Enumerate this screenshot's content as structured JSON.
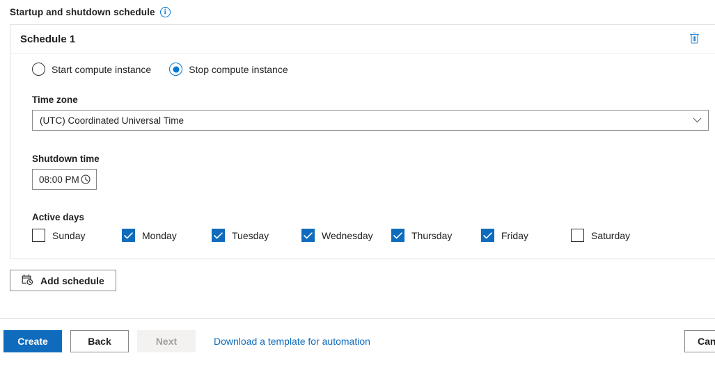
{
  "section": {
    "title": "Startup and shutdown schedule",
    "info_icon": "info-icon",
    "info_glyph": "i"
  },
  "card": {
    "title": "Schedule 1",
    "delete_icon": "trash-icon",
    "delete_color": "#0f6cbd",
    "action_radios": {
      "options": [
        {
          "label": "Start compute instance",
          "selected": false
        },
        {
          "label": "Stop compute instance",
          "selected": true
        }
      ]
    },
    "timezone": {
      "label": "Time zone",
      "value": "(UTC) Coordinated Universal Time",
      "chevron_icon": "chevron-down-icon"
    },
    "shutdown_time": {
      "label": "Shutdown time",
      "value": "08:00 PM",
      "clock_icon": "clock-icon"
    },
    "active_days": {
      "label": "Active days",
      "days": [
        {
          "label": "Sunday",
          "checked": false
        },
        {
          "label": "Monday",
          "checked": true
        },
        {
          "label": "Tuesday",
          "checked": true
        },
        {
          "label": "Wednesday",
          "checked": true
        },
        {
          "label": "Thursday",
          "checked": true
        },
        {
          "label": "Friday",
          "checked": true
        },
        {
          "label": "Saturday",
          "checked": false
        }
      ]
    }
  },
  "add_schedule": {
    "label": "Add schedule",
    "icon": "calendar-clock-icon"
  },
  "footer": {
    "create_label": "Create",
    "back_label": "Back",
    "next_label": "Next",
    "next_disabled": true,
    "template_link": "Download a template for automation",
    "cancel_label": "Cancel"
  },
  "colors": {
    "accent": "#0f6cbd",
    "link": "#0f6cbd",
    "radio_accent": "#0078d4",
    "border": "#8a8886",
    "card_border": "#e1dfdd"
  }
}
